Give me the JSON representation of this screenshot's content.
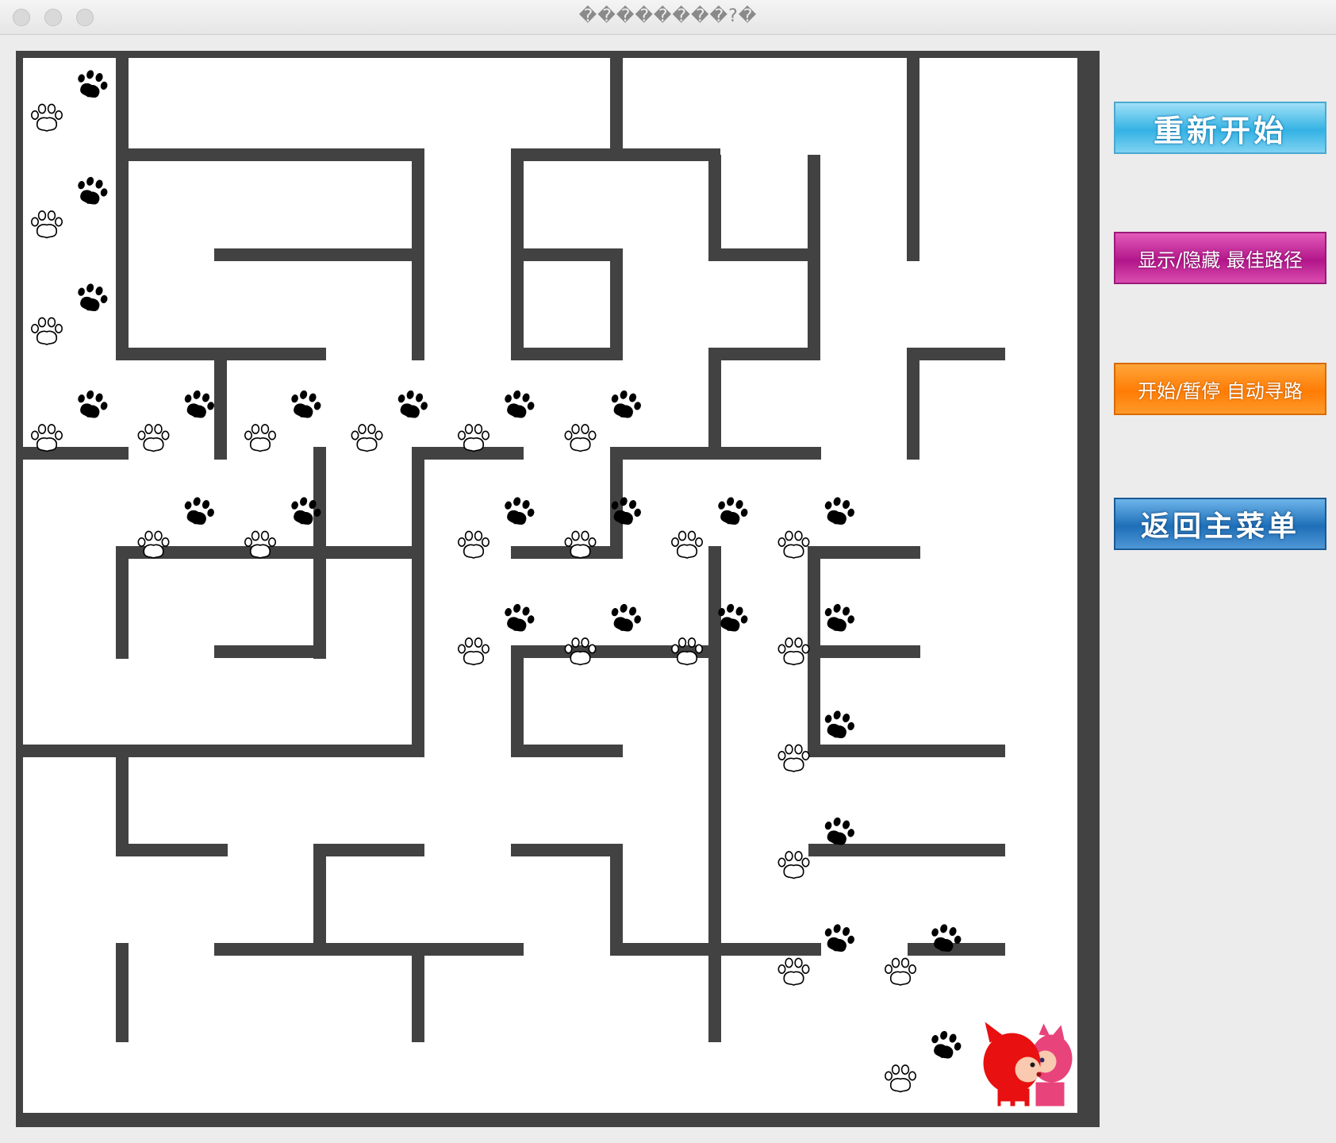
{
  "window": {
    "title": "��������?�"
  },
  "buttons": {
    "restart": "重新开始",
    "toggle_path": "显示/隐藏 最佳路径",
    "auto_route": "开始/暂停 自动寻路",
    "main_menu": "返回主菜单"
  },
  "icons": {
    "paw": "paw-icon",
    "character": "fox-kissing-characters"
  },
  "colors": {
    "wall": "#424242",
    "floor": "#ffffff",
    "paw_filled": "#000000",
    "paw_outline": "#000000"
  },
  "maze": {
    "rows": 10,
    "cols": 10,
    "paw_path": [
      [
        0,
        0
      ],
      [
        1,
        0
      ],
      [
        2,
        0
      ],
      [
        3,
        0
      ],
      [
        3,
        1
      ],
      [
        3,
        2
      ],
      [
        3,
        3
      ],
      [
        3,
        4
      ],
      [
        3,
        5
      ],
      [
        4,
        1
      ],
      [
        4,
        2
      ],
      [
        4,
        4
      ],
      [
        4,
        5
      ],
      [
        4,
        6
      ],
      [
        4,
        7
      ],
      [
        5,
        4
      ],
      [
        5,
        5
      ],
      [
        5,
        6
      ],
      [
        5,
        7
      ],
      [
        6,
        7
      ],
      [
        7,
        7
      ],
      [
        8,
        7
      ],
      [
        8,
        8
      ],
      [
        9,
        8
      ]
    ],
    "goal_cell": [
      9,
      9
    ]
  }
}
